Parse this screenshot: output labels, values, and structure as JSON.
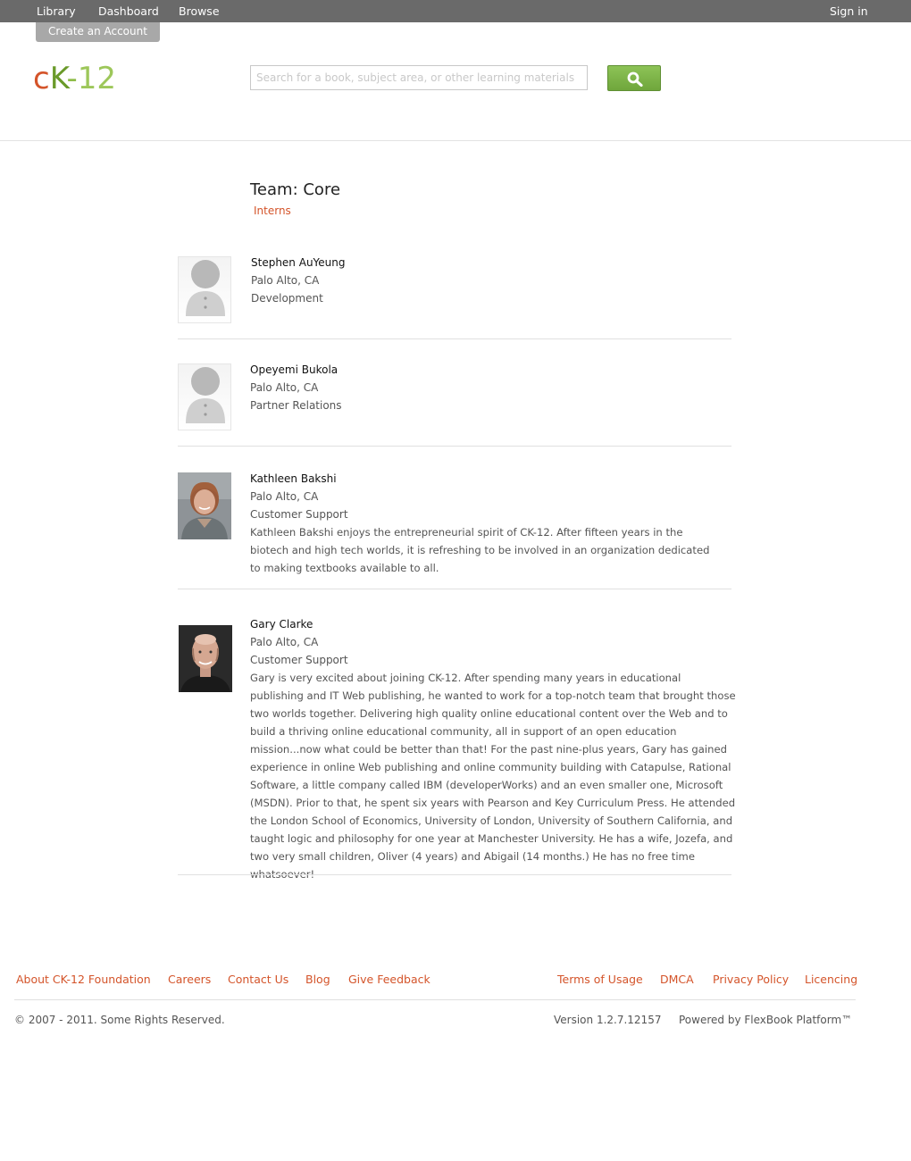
{
  "topbar": {
    "nav": [
      "Library",
      "Dashboard",
      "Browse"
    ],
    "signin": "Sign in",
    "create_account": "Create an Account"
  },
  "logo": {
    "c": "c",
    "k": "K",
    "dash": "-",
    "num": "12"
  },
  "search": {
    "placeholder": "Search for a book, subject area, or other learning materials"
  },
  "page": {
    "title": "Team: Core",
    "subnav": "Interns"
  },
  "members": [
    {
      "name": "Stephen AuYeung",
      "location": "Palo Alto, CA",
      "role": "Development",
      "bio": ""
    },
    {
      "name": "Opeyemi Bukola",
      "location": "Palo Alto, CA",
      "role": "Partner Relations",
      "bio": ""
    },
    {
      "name": "Kathleen Bakshi",
      "location": "Palo Alto, CA",
      "role": "Customer Support",
      "bio": "Kathleen Bakshi enjoys the entrepreneurial spirit of CK-12.  After fifteen years in the biotech and high tech worlds, it is refreshing to be involved in an organization dedicated to making textbooks available to all."
    },
    {
      "name": "Gary Clarke",
      "location": "Palo Alto, CA",
      "role": "Customer Support",
      "bio": "Gary is very excited about joining CK-12. After spending many years in educational publishing and IT Web publishing, he wanted to work for a top-notch team that brought those two worlds together. Delivering high quality online educational content over the Web and to build a thriving online educational community, all in support of an open education mission...now what could be better than that! For the past nine-plus years, Gary has gained experience in online Web publishing and online community building with Catapulse, Rational Software,  a little company called IBM (developerWorks) and an even smaller one, Microsoft (MSDN). Prior to that, he spent six years with Pearson and Key Curriculum Press. He attended the London School of Economics, University of London, University of Southern California, and taught logic and philosophy for one year at Manchester University.  He has a wife, Jozefa, and two very small children, Oliver (4 years) and Abigail (14 months.)  He has no free time whatsoever!"
    }
  ],
  "footer": {
    "left_links": [
      "About CK-12 Foundation",
      "Careers",
      "Contact Us",
      "Blog",
      "Give Feedback"
    ],
    "right_links": [
      "Terms of Usage",
      "DMCA",
      "Privacy Policy",
      "Licencing"
    ],
    "copyright": "© 2007 - 2011. Some Rights Reserved.",
    "version": "Version 1.2.7.12157",
    "powered": "Powered by FlexBook Platform™"
  }
}
